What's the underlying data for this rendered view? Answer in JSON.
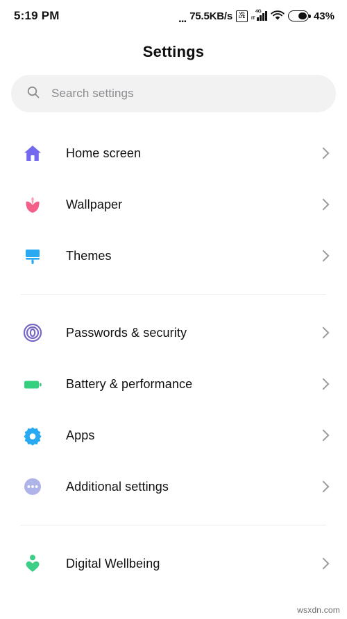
{
  "status_bar": {
    "time": "5:19 PM",
    "net_dots": "...",
    "net_speed": "75.5KB/s",
    "volte_top": "VO",
    "volte_bottom": "LTE",
    "signal_label": "4G",
    "signal_sub": "IT",
    "battery_percent": "43%",
    "icons": [
      "volte-icon",
      "signal-4g-icon",
      "wifi-icon",
      "battery-icon"
    ]
  },
  "header": {
    "title": "Settings"
  },
  "search": {
    "placeholder": "Search settings",
    "icon": "search-icon"
  },
  "groups": [
    {
      "items": [
        {
          "label": "Home screen",
          "icon": "home-icon",
          "color": "#7468ee"
        },
        {
          "label": "Wallpaper",
          "icon": "flower-icon",
          "color": "#f2608a"
        },
        {
          "label": "Themes",
          "icon": "paintbrush-icon",
          "color": "#29a9f2"
        }
      ]
    },
    {
      "items": [
        {
          "label": "Passwords & security",
          "icon": "fingerprint-icon",
          "color": "#7568c4"
        },
        {
          "label": "Battery & performance",
          "icon": "battery-icon",
          "color": "#35d07f"
        },
        {
          "label": "Apps",
          "icon": "gear-icon",
          "color": "#29a9f2"
        },
        {
          "label": "Additional settings",
          "icon": "more-dots-icon",
          "color": "#aeb4e8"
        }
      ]
    },
    {
      "items": [
        {
          "label": "Digital Wellbeing",
          "icon": "wellbeing-icon",
          "color": "#3ecf87"
        }
      ]
    }
  ],
  "watermark": "wsxdn.com"
}
